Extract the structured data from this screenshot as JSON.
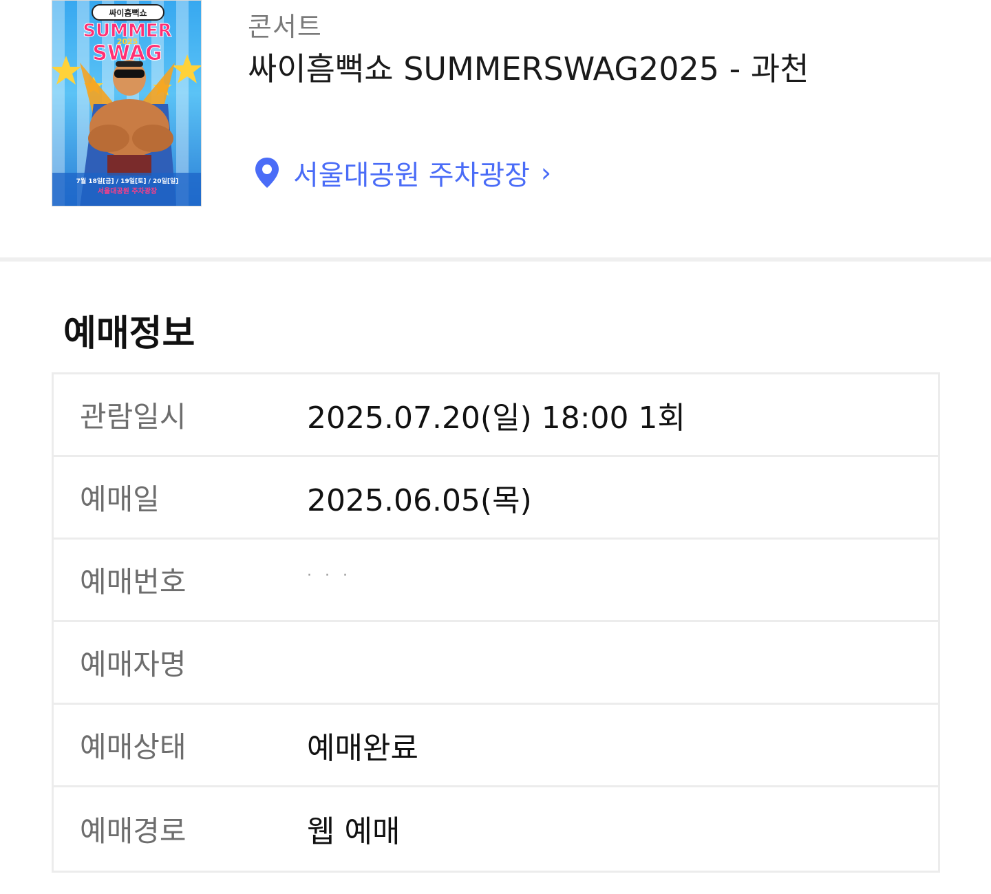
{
  "event": {
    "category": "콘서트",
    "title": "싸이흠뻑쇼 SUMMERSWAG2025 - 과천",
    "venue": "서울대공원 주차광장",
    "poster": {
      "brand": "싸이흠뻑쇼",
      "line1": "SUMMER",
      "year": "2025",
      "line2": "SWAG",
      "dates": "7월 18일[금] / 19일[토] / 20일[일]",
      "venue": "서울대공원 주차광장"
    }
  },
  "booking_info": {
    "section_title": "예매정보",
    "rows": [
      {
        "label": "관람일시",
        "value": "2025.07.20(일) 18:00 1회"
      },
      {
        "label": "예매일",
        "value": "2025.06.05(목)"
      },
      {
        "label": "예매번호",
        "value": ""
      },
      {
        "label": "예매자명",
        "value": ""
      },
      {
        "label": "예매상태",
        "value": "예매완료"
      },
      {
        "label": "예매경로",
        "value": "웹 예매"
      }
    ]
  },
  "colors": {
    "accent": "#4a6cf7",
    "label_gray": "#6d6d6d",
    "border": "#ececec"
  },
  "icons": {
    "venue_icon": "location-pin-icon",
    "venue_chevron": "chevron-right-icon"
  }
}
